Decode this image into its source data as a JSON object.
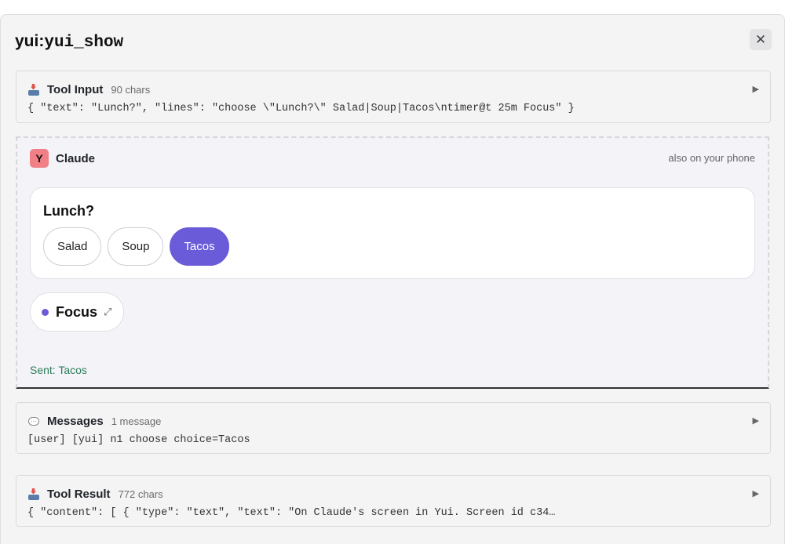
{
  "header": {
    "title_prefix": "yui:",
    "title_name": "yui_show",
    "close_glyph": "✕"
  },
  "tool_input": {
    "icon": "inbox-tray-icon",
    "title": "Tool Input",
    "meta": "90 chars",
    "toggle": "▶",
    "body": "{ \"text\": \"Lunch?\", \"lines\": \"choose \\\"Lunch?\\\" Salad|Soup|Tacos\\ntimer@t 25m Focus\" }"
  },
  "yui_screen": {
    "avatar_letter": "Y",
    "agent_name": "Claude",
    "phone_note": "also on your phone",
    "choice": {
      "question": "Lunch?",
      "options": [
        "Salad",
        "Soup",
        "Tacos"
      ],
      "selected": "Tacos"
    },
    "timer": {
      "label": "Focus",
      "expand_glyph": "⤢"
    },
    "sent_status": "Sent: Tacos"
  },
  "messages": {
    "icon": "speech-bubble-icon",
    "title": "Messages",
    "meta": "1 message",
    "toggle": "▶",
    "body": "[user] [yui] n1 choose choice=Tacos"
  },
  "tool_result": {
    "icon": "inbox-tray-icon",
    "title": "Tool Result",
    "meta": "772 chars",
    "toggle": "▶",
    "body": "{ \"content\": [ { \"type\": \"text\", \"text\": \"On Claude's screen in Yui. Screen id c34…"
  },
  "colors": {
    "accent": "#6a5bd8",
    "avatar": "#f07f86",
    "sent": "#2f7d5a"
  }
}
